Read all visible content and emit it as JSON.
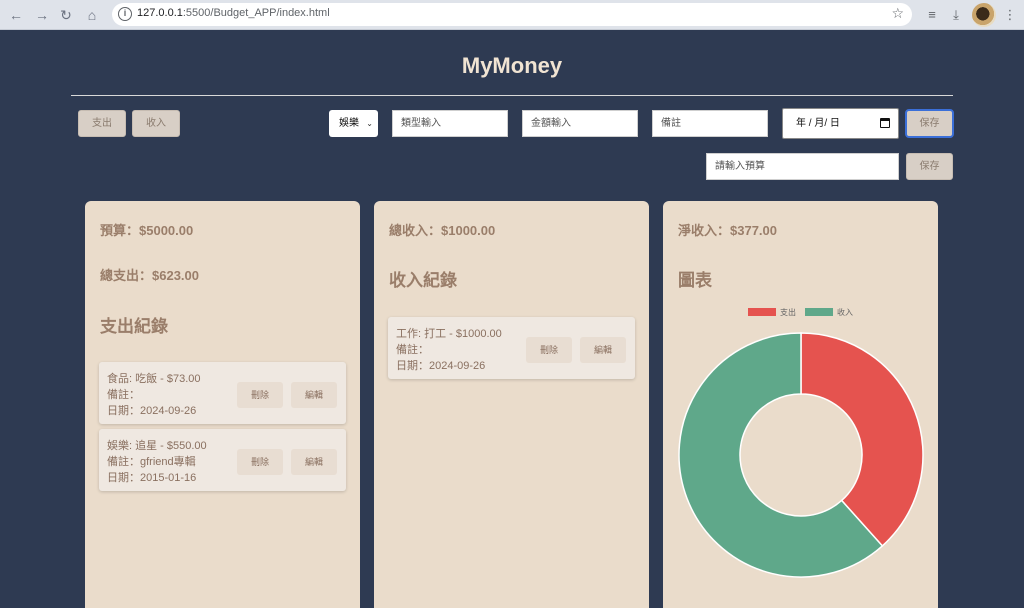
{
  "browser": {
    "url_host": "127.0.0.1",
    "url_rest": ":5500/Budget_APP/index.html"
  },
  "app": {
    "title": "MyMoney"
  },
  "toolbar": {
    "expense_tab": "支出",
    "income_tab": "收入",
    "category_selected": "娛樂",
    "type_placeholder": "類型輸入",
    "amount_placeholder": "金額輸入",
    "note_placeholder": "備註",
    "date_placeholder": "年 / 月/ 日",
    "save_label": "保存",
    "budget_placeholder": "請輸入預算",
    "budget_save_label": "保存"
  },
  "expense_card": {
    "budget_label": "預算：$5000.00",
    "total_expense_label": "總支出：$623.00",
    "heading": "支出紀錄",
    "records": [
      {
        "title": "食品: 吃飯 - $73.00",
        "note": "備註：",
        "date": "日期：2024-09-26"
      },
      {
        "title": "娛樂: 追星 - $550.00",
        "note": "備註：gfriend專輯",
        "date": "日期：2015-01-16"
      }
    ]
  },
  "income_card": {
    "total_income_label": "總收入：$1000.00",
    "heading": "收入紀錄",
    "records": [
      {
        "title": "工作: 打工 - $1000.00",
        "note": "備註：",
        "date": "日期：2024-09-26"
      }
    ]
  },
  "chart_card": {
    "net_income_label": "淨收入：$377.00",
    "heading": "圖表"
  },
  "record_actions": {
    "delete_label": "刪除",
    "edit_label": "編輯"
  },
  "colors": {
    "expense": "#e5534f",
    "income": "#5fa88a",
    "page_bg": "#2e3a52",
    "card_bg": "#eadccb"
  },
  "chart_data": {
    "type": "pie",
    "categories": [
      "支出",
      "收入"
    ],
    "values": [
      623,
      1000
    ],
    "colors": [
      "#e5534f",
      "#5fa88a"
    ],
    "title": "",
    "legend": "top"
  }
}
